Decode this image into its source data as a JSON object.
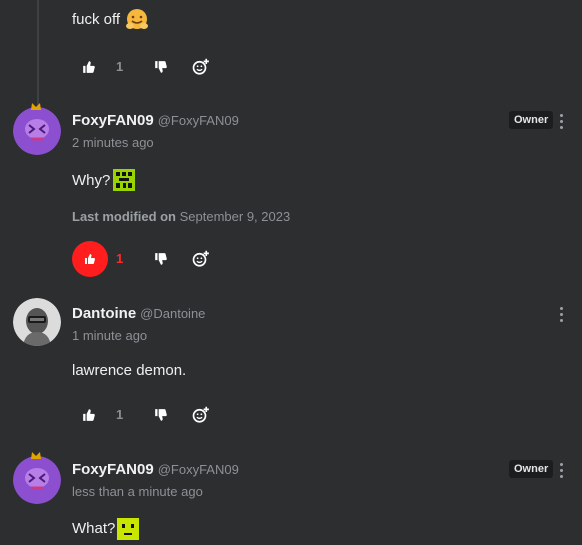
{
  "comments": [
    {
      "text": "fuck off",
      "emoji": "hugging-face-emoji",
      "likes": "1"
    },
    {
      "author": "FoxyFAN09",
      "handle": "@FoxyFAN09",
      "time": "2 minutes ago",
      "badge": "Owner",
      "text": "Why?",
      "emoji": "green-pixel-emoji",
      "modified_label": "Last modified on",
      "modified_date": "September 9, 2023",
      "likes": "1",
      "liked": true
    },
    {
      "author": "Dantoine",
      "handle": "@Dantoine",
      "time": "1 minute ago",
      "text": "lawrence demon.",
      "likes": "1"
    },
    {
      "author": "FoxyFAN09",
      "handle": "@FoxyFAN09",
      "time": "less than a minute ago",
      "badge": "Owner",
      "text": "What?",
      "emoji": "yellow-pixel-emoji"
    }
  ],
  "colors": {
    "background": "#2c2e30",
    "like_active": "#ff1d1d",
    "muted_text": "#8d9195"
  },
  "icons": [
    "thumbs-up-icon",
    "thumbs-down-icon",
    "add-reaction-icon",
    "more-options-icon"
  ]
}
